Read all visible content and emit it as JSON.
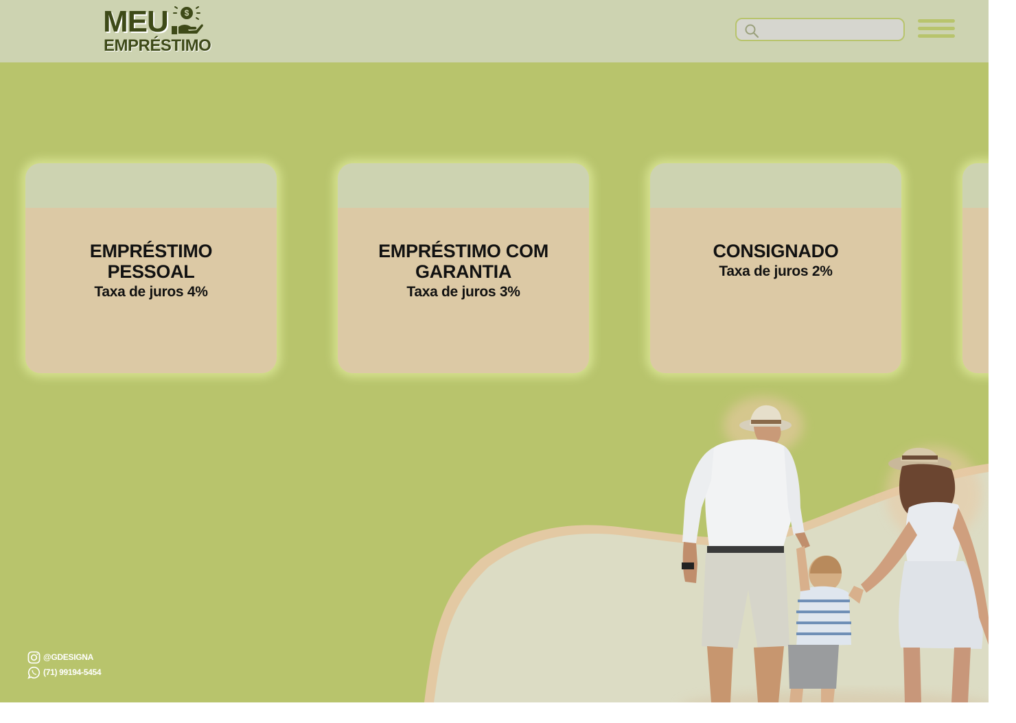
{
  "header": {
    "logo_line1": "MEU",
    "logo_line2": "EMPRÉSTIMO",
    "logo_icon": "hand-holding-coin-icon",
    "search": {
      "placeholder": "",
      "icon": "search-icon"
    },
    "menu_icon": "hamburger-menu-icon"
  },
  "cards": [
    {
      "title": "EMPRÉSTIMO PESSOAL",
      "rate": "Taxa de juros  4%"
    },
    {
      "title": "EMPRÉSTIMO COM GARANTIA",
      "rate": "Taxa de juros  3%"
    },
    {
      "title": "CONSIGNADO",
      "rate": "Taxa de juros  2%"
    },
    {
      "title": "",
      "rate": ""
    }
  ],
  "contacts": {
    "instagram": {
      "icon": "instagram-icon",
      "handle": "@GDESIGNA"
    },
    "whatsapp": {
      "icon": "whatsapp-icon",
      "phone": "(71) 99194-5454"
    }
  },
  "hero_image": {
    "description_icon": "family-walking-photo"
  },
  "colors": {
    "background": "#b8c46c",
    "header": "#cdd3b1",
    "card": "#dcc9a5",
    "logo": "#3e4a18",
    "hill": "#dcdcc4"
  }
}
